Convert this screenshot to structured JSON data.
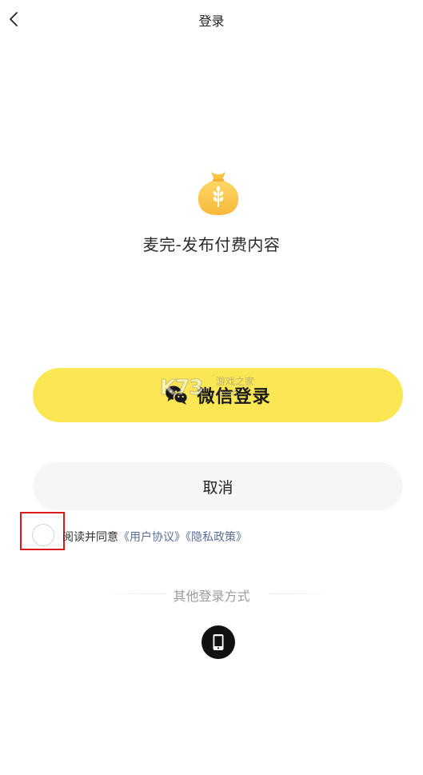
{
  "nav": {
    "title": "登录",
    "back_icon": "chevron-left-icon"
  },
  "app": {
    "logo_icon": "money-bag-wheat-icon",
    "name": "麦完-发布付费内容",
    "brand_color": "#fbe654"
  },
  "login": {
    "wechat_label": "微信登录",
    "wechat_icon": "wechat-icon",
    "cancel_label": "取消"
  },
  "agreement": {
    "prefix": "阅读并同意",
    "user_agreement": "《用户协议》",
    "privacy_policy": "《隐私政策》",
    "checked": false
  },
  "other_methods": {
    "label": "其他登录方式",
    "phone_icon": "mobile-phone-icon"
  },
  "watermark": {
    "letters": "K73",
    "subtitle": "游戏之家",
    "url": ".com"
  }
}
